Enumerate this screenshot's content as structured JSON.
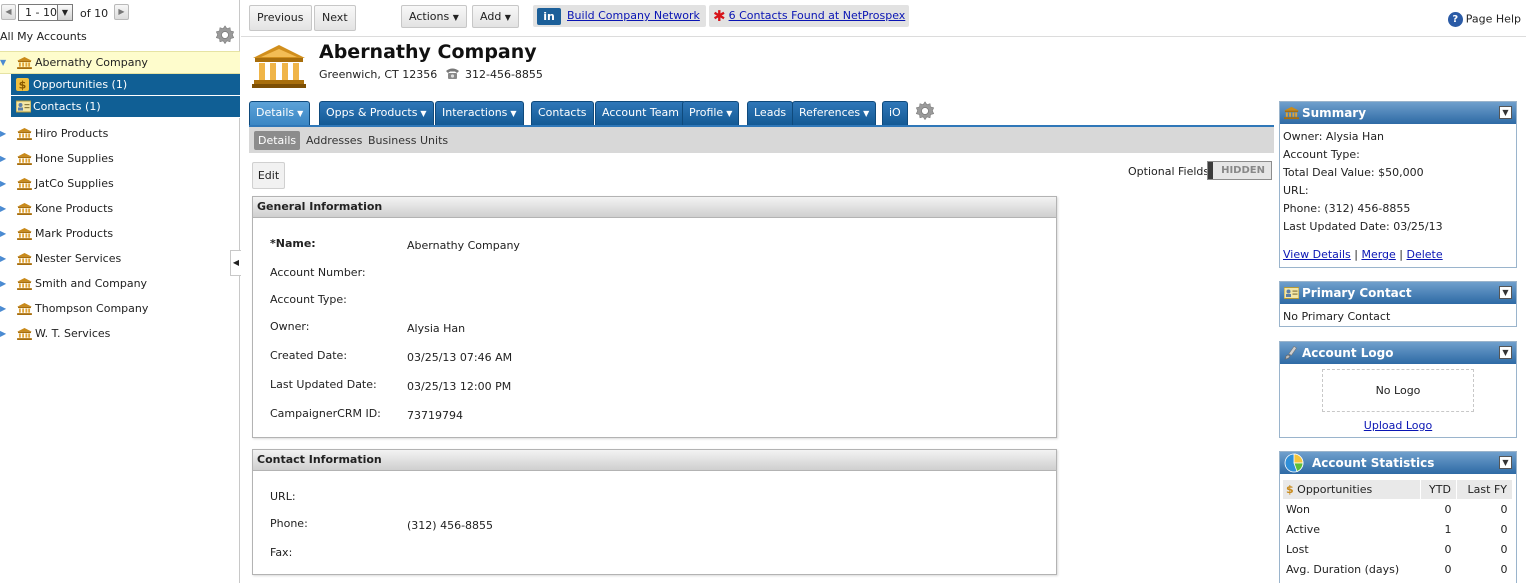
{
  "pager": {
    "range": "1 - 10",
    "of_label": "of 10"
  },
  "sidebar": {
    "all_label": "All My Accounts",
    "selected": {
      "name": "Abernathy Company",
      "subs": [
        "Opportunities (1)",
        "Contacts (1)"
      ]
    },
    "accounts": [
      "Hiro Products",
      "Hone Supplies",
      "JatCo Supplies",
      "Kone Products",
      "Mark Products",
      "Nester Services",
      "Smith and Company",
      "Thompson Company",
      "W. T. Services"
    ]
  },
  "toolbar": {
    "previous": "Previous",
    "next": "Next",
    "actions": "Actions",
    "add": "Add",
    "linkedin_logo": "in",
    "linkedin_link": "Build Company Network",
    "netprospex_link": "6 Contacts Found at NetProspex",
    "help": "Page Help"
  },
  "account": {
    "name": "Abernathy Company",
    "address": "Greenwich, CT 12356",
    "phone": "312-456-8855"
  },
  "tabs": [
    "Details",
    "Opps & Products",
    "Interactions",
    "Contacts",
    "Account Team",
    "Profile",
    "Leads",
    "References",
    "iO"
  ],
  "subtabs": [
    "Details",
    "Addresses",
    "Business Units"
  ],
  "content": {
    "edit": "Edit",
    "optional_fields_label": "Optional Fields:",
    "optional_fields_state": "HIDDEN",
    "general": {
      "title": "General Information",
      "fields": [
        {
          "label": "*Name:",
          "value": "Abernathy Company"
        },
        {
          "label": "Account Number:",
          "value": ""
        },
        {
          "label": "Account Type:",
          "value": ""
        },
        {
          "label": "Owner:",
          "value": "Alysia Han"
        },
        {
          "label": "Created Date:",
          "value": "03/25/13 07:46 AM"
        },
        {
          "label": "Last Updated Date:",
          "value": "03/25/13 12:00 PM"
        },
        {
          "label": "CampaignerCRM ID:",
          "value": "73719794"
        }
      ]
    },
    "contact": {
      "title": "Contact Information",
      "fields": [
        {
          "label": "URL:",
          "value": ""
        },
        {
          "label": "Phone:",
          "value": "(312) 456-8855"
        },
        {
          "label": "Fax:",
          "value": ""
        }
      ]
    }
  },
  "summary": {
    "title": "Summary",
    "lines": [
      "Owner: Alysia Han",
      "Account Type:",
      "Total Deal Value: $50,000",
      "URL:",
      "Phone: (312) 456-8855",
      "Last Updated Date: 03/25/13"
    ],
    "links": [
      "View Details",
      "Merge",
      "Delete"
    ]
  },
  "primary_contact": {
    "title": "Primary Contact",
    "text": "No Primary Contact"
  },
  "account_logo": {
    "title": "Account Logo",
    "text": "No Logo",
    "upload": "Upload Logo"
  },
  "account_stats": {
    "title": "Account Statistics",
    "headers": [
      "Opportunities",
      "YTD",
      "Last FY"
    ],
    "rows": [
      [
        "Won",
        "0",
        "0"
      ],
      [
        "Active",
        "1",
        "0"
      ],
      [
        "Lost",
        "0",
        "0"
      ],
      [
        "Avg. Duration (days)",
        "0",
        "0"
      ]
    ]
  },
  "colors": {
    "tab_blue": "#145a95",
    "selected_row": "#fefccc",
    "link": "#0a15b4",
    "widget_head": "#2e6aa5"
  }
}
